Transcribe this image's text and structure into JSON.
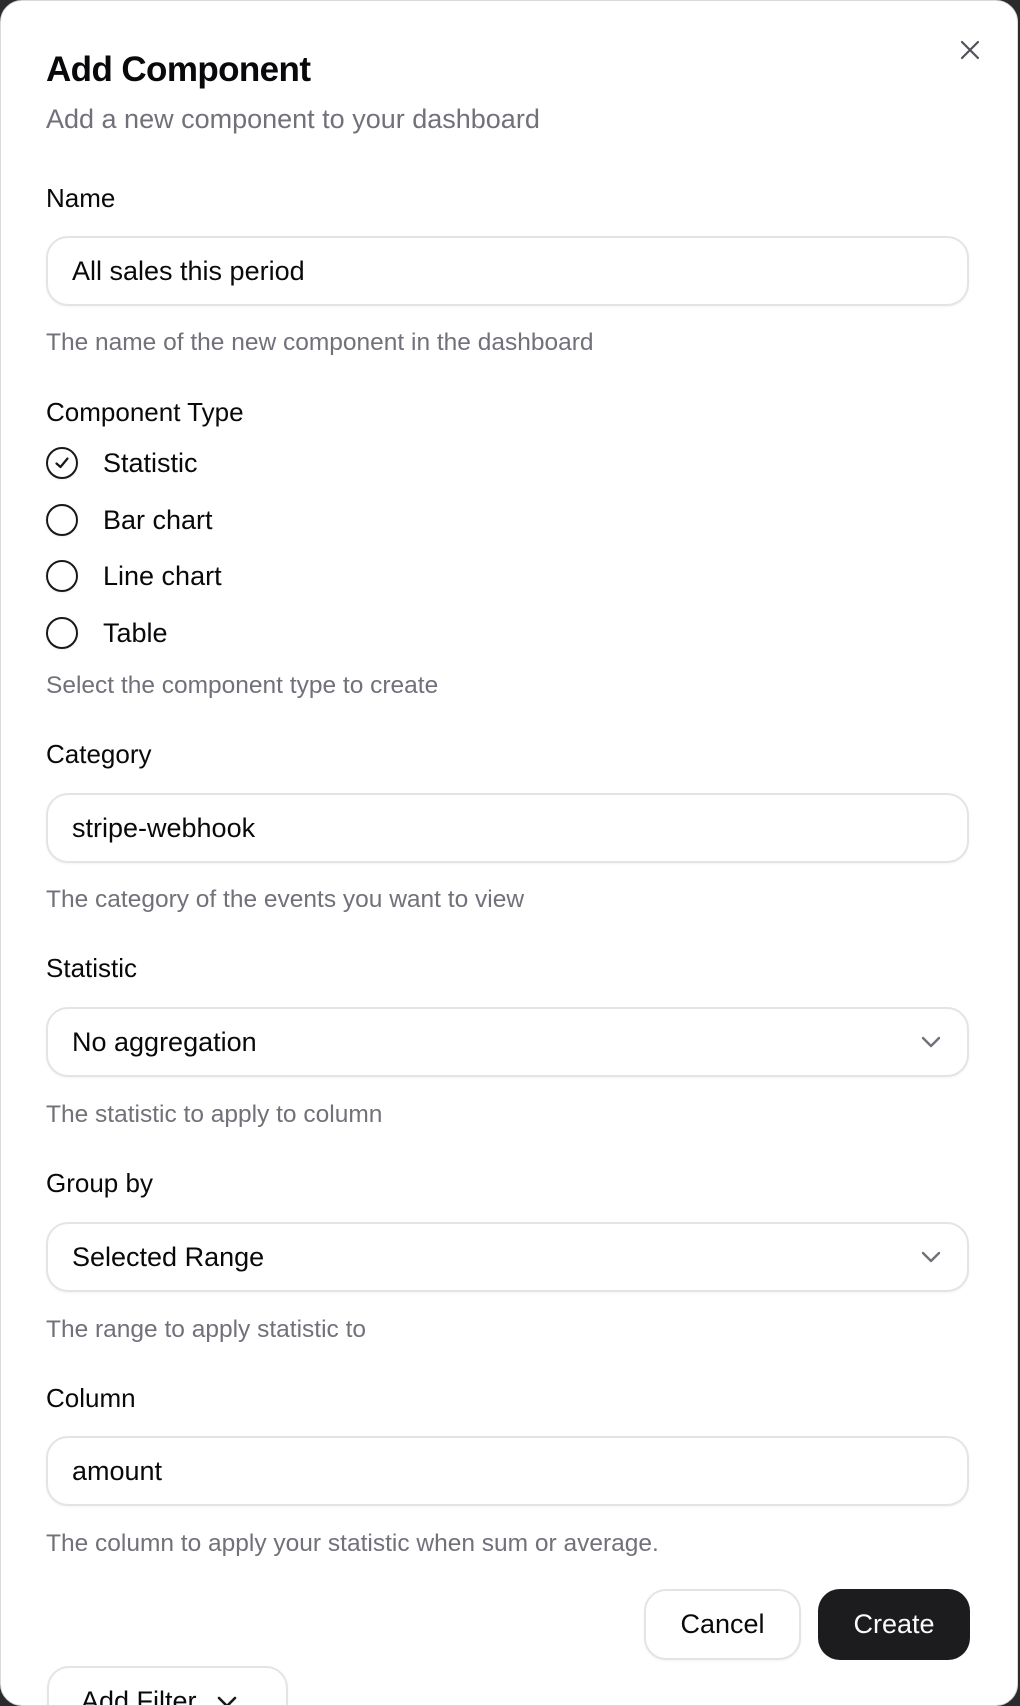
{
  "dialog": {
    "title": "Add Component",
    "subtitle": "Add a new component to your dashboard",
    "close_icon": "close-icon"
  },
  "fields": {
    "name": {
      "label": "Name",
      "value": "All sales this period",
      "helper": "The name of the new component in the dashboard"
    },
    "component_type": {
      "label": "Component Type",
      "options": [
        {
          "label": "Statistic",
          "selected": true
        },
        {
          "label": "Bar chart",
          "selected": false
        },
        {
          "label": "Line chart",
          "selected": false
        },
        {
          "label": "Table",
          "selected": false
        }
      ],
      "helper": "Select the component type to create"
    },
    "category": {
      "label": "Category",
      "value": "stripe-webhook",
      "helper": "The category of the events you want to view"
    },
    "statistic": {
      "label": "Statistic",
      "value": "No aggregation",
      "helper": "The statistic to apply to column"
    },
    "group_by": {
      "label": "Group by",
      "value": "Selected Range",
      "helper": "The range to apply statistic to"
    },
    "column": {
      "label": "Column",
      "value": "amount",
      "helper": "The column to apply your statistic when sum or average."
    }
  },
  "actions": {
    "cancel_label": "Cancel",
    "create_label": "Create",
    "add_filter_label": "Add Filter"
  },
  "colors": {
    "primary_button": "#1c1c1e",
    "text": "#09090b",
    "muted_text": "#71717a",
    "border": "#e4e4e7"
  }
}
